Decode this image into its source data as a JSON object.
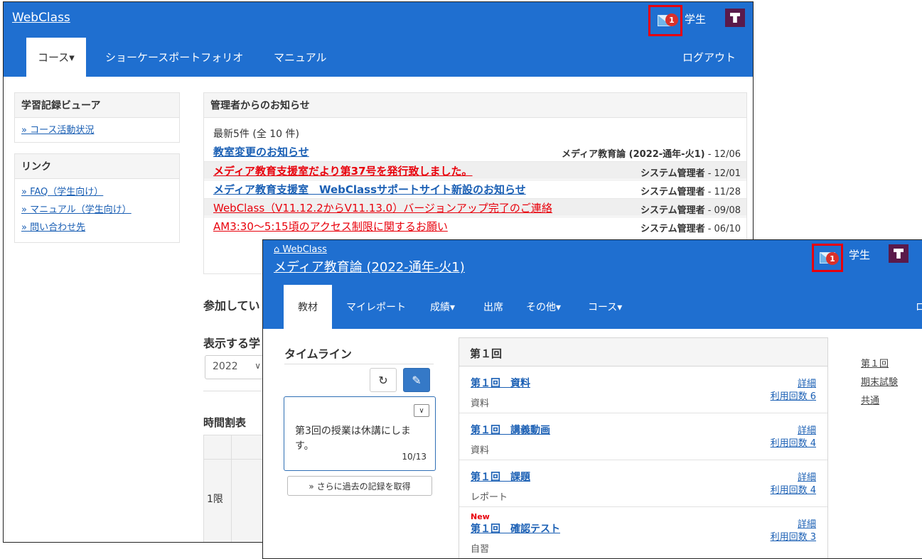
{
  "back_window": {
    "brand": "WebClass",
    "mail_badge": "1",
    "user_label": "学生",
    "nav": {
      "course_tab": "コース▾",
      "showcase_tab": "ショーケースポートフォリオ",
      "manual_tab": "マニュアル",
      "logout": "ログアウト"
    },
    "learning_viewer": {
      "heading": "学習記録ビューア",
      "link": "» コース活動状況"
    },
    "links": {
      "heading": "リンク",
      "items": [
        "» FAQ（学生向け）",
        "» マニュアル（学生向け）",
        "» 問い合わせ先"
      ]
    },
    "notices": {
      "heading": "管理者からのお知らせ",
      "summary": "最新5件 (全 10 件)",
      "items": [
        {
          "title": "教室変更のお知らせ",
          "author": "メディア教育論 (2022-通年-火1)",
          "date": " - 12/06",
          "style": "blue"
        },
        {
          "title": "メディア教育支援室だより第37号を発行致しました。",
          "author": "システム管理者",
          "date": " - 12/01",
          "style": "redb"
        },
        {
          "title": "メディア教育支援室　WebClassサポートサイト新設のお知らせ",
          "author": "システム管理者",
          "date": " - 11/28",
          "style": "blue"
        },
        {
          "title": "WebClass（V11.12.2からV11.13.0）バージョンアップ完了のご連絡",
          "author": "システム管理者",
          "date": " - 09/08",
          "style": "red"
        },
        {
          "title": "AM3:30〜5:15頃のアクセス制限に関するお願い",
          "author": "システム管理者",
          "date": " - 06/10",
          "style": "red"
        }
      ]
    },
    "participating_heading": "参加してい",
    "display_heading": "表示する学",
    "year_select": "2022",
    "timetable": {
      "heading": "時間割表",
      "period": "1限"
    }
  },
  "front_window": {
    "home_link": "WebClass",
    "course_title": "メディア教育論 (2022-通年-火1)",
    "mail_badge": "1",
    "user_label": "学生",
    "nav": {
      "materials": "教材",
      "my_report": "マイレポート",
      "grades": "成績▾",
      "attendance": "出席",
      "other": "その他▾",
      "course": "コース▾",
      "logout_partial": "ロ"
    },
    "timeline": {
      "heading": "タイムライン",
      "post_text": "第3回の授業は休講にします。",
      "post_date": "10/13",
      "more_button": "» さらに過去の記録を取得"
    },
    "materials_panel": {
      "heading": "第１回",
      "items": [
        {
          "title": "第１回　資料",
          "type": "資料",
          "detail": "詳細",
          "count": "利用回数 6",
          "new": ""
        },
        {
          "title": "第１回　講義動画",
          "type": "資料",
          "detail": "詳細",
          "count": "利用回数 4",
          "new": ""
        },
        {
          "title": "第１回　課題",
          "type": "レポート",
          "detail": "詳細",
          "count": "利用回数 4",
          "new": ""
        },
        {
          "title": "第１回　確認テスト",
          "type": "自習",
          "detail": "詳細",
          "count": "利用回数 3",
          "new": "New"
        }
      ]
    },
    "side_links": [
      "第１回",
      "期末試験",
      "共通"
    ]
  },
  "colors": {
    "header_blue": "#1f6fd0",
    "highlight_red": "#e8000b",
    "link_blue": "#1a5fb4"
  }
}
